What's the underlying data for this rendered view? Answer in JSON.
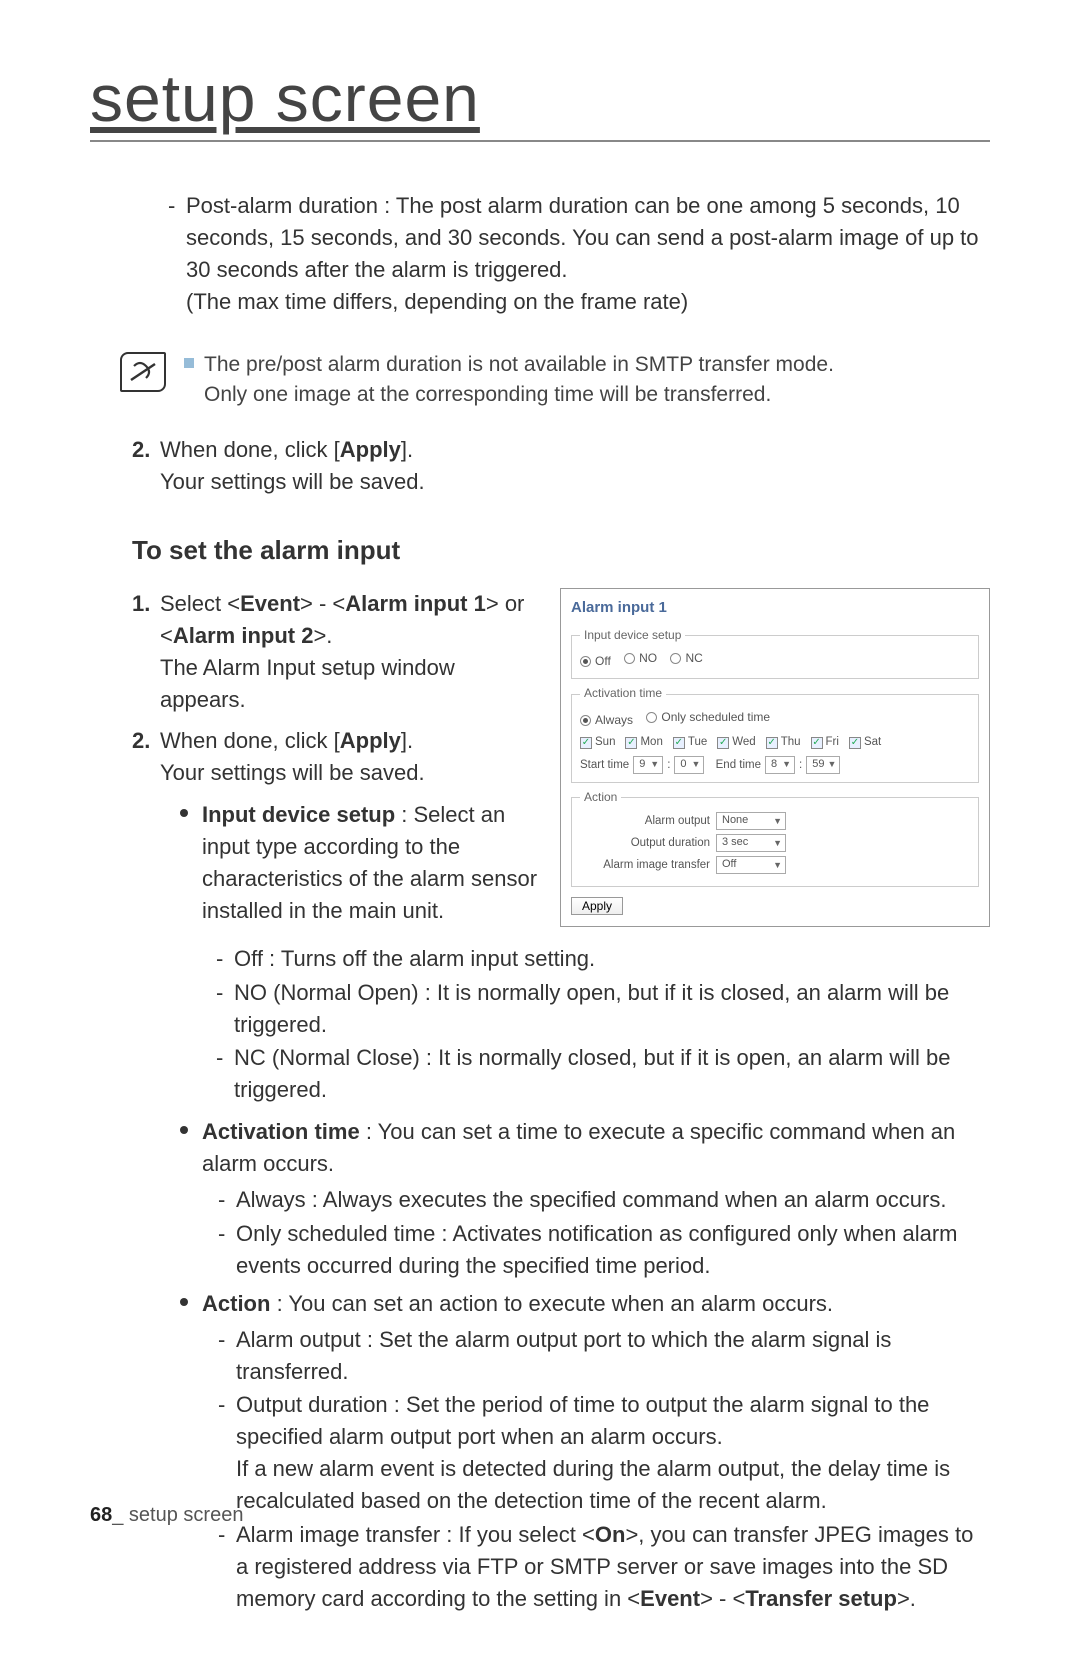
{
  "page_title": "setup screen",
  "post_alarm": "Post-alarm duration : The post alarm duration can be one among 5 seconds, 10 seconds, 15 seconds, and 30 seconds. You can send a post-alarm image of up to 30 seconds after the alarm is triggered.\n(The max time differs, depending on the frame rate)",
  "note_line1": "The pre/post alarm duration is not available in SMTP transfer mode.",
  "note_line2": "Only one image at the corresponding time will be transferred.",
  "step2a_prefix": "When done, click [",
  "step2a_bold": "Apply",
  "step2a_suffix": "].",
  "step2a_line2": "Your settings will be saved.",
  "heading": "To set the alarm input",
  "step1_prefix": "Select <",
  "step1_b1": "Event",
  "step1_mid1": "> - <",
  "step1_b2": "Alarm input 1",
  "step1_mid2": "> or <",
  "step1_b3": "Alarm input 2",
  "step1_suffix": ">.",
  "step1_line2": "The Alarm Input setup window appears.",
  "step2b_prefix": "When done, click [",
  "step2b_bold": "Apply",
  "step2b_suffix": "].",
  "step2b_line2": "Your settings will be saved.",
  "input_device_b": "Input device setup",
  "input_device_rest": " : Select an input type according to the characteristics of the alarm sensor installed in the main unit.",
  "ids_off": "Off : Turns off the alarm input setting.",
  "ids_no": "NO (Normal Open) : It is normally open, but if it is closed, an alarm will be triggered.",
  "ids_nc": "NC (Normal Close) : It is normally closed, but if it is open, an alarm will be triggered.",
  "act_time_b": "Activation time",
  "act_time_rest": " : You can set a time to execute a specific command when an alarm occurs.",
  "at_always": "Always : Always executes the specified command when an alarm occurs.",
  "at_sched": "Only scheduled time : Activates notification as configured only when alarm events occurred during the specified time period.",
  "action_b": "Action",
  "action_rest": " : You can set an action to execute when an alarm occurs.",
  "ac_output": "Alarm output : Set the alarm output port to which the alarm signal is transferred.",
  "ac_dur": "Output duration : Set the period of time to output the alarm signal to the specified alarm output port when an alarm occurs.\nIf a new alarm event is detected during the alarm output, the delay time is recalculated based on the detection time of the recent alarm.",
  "ac_img_prefix": "Alarm image transfer : If you select <",
  "ac_img_b": "On",
  "ac_img_mid": ">, you can transfer JPEG images to a registered address via FTP or SMTP server or save images into the SD memory card according to the setting in <",
  "ac_img_b2": "Event",
  "ac_img_mid2": "> - <",
  "ac_img_b3": "Transfer setup",
  "ac_img_suffix": ">.",
  "footer_num": "68",
  "footer_text": "_ setup screen",
  "ui": {
    "title": "Alarm input 1",
    "legend_input": "Input device setup",
    "r_off": "Off",
    "r_no": "NO",
    "r_nc": "NC",
    "legend_time": "Activation time",
    "r_always": "Always",
    "r_sched": "Only scheduled time",
    "days": [
      "Sun",
      "Mon",
      "Tue",
      "Wed",
      "Thu",
      "Fri",
      "Sat"
    ],
    "start_label": "Start time",
    "end_label": "End time",
    "start_h": "9",
    "start_m": "0",
    "end_h": "8",
    "end_m": "59",
    "legend_action": "Action",
    "row_alarm_out": "Alarm output",
    "val_alarm_out": "None",
    "row_out_dur": "Output duration",
    "val_out_dur": "3 sec",
    "row_img": "Alarm image transfer",
    "val_img": "Off",
    "apply": "Apply"
  }
}
